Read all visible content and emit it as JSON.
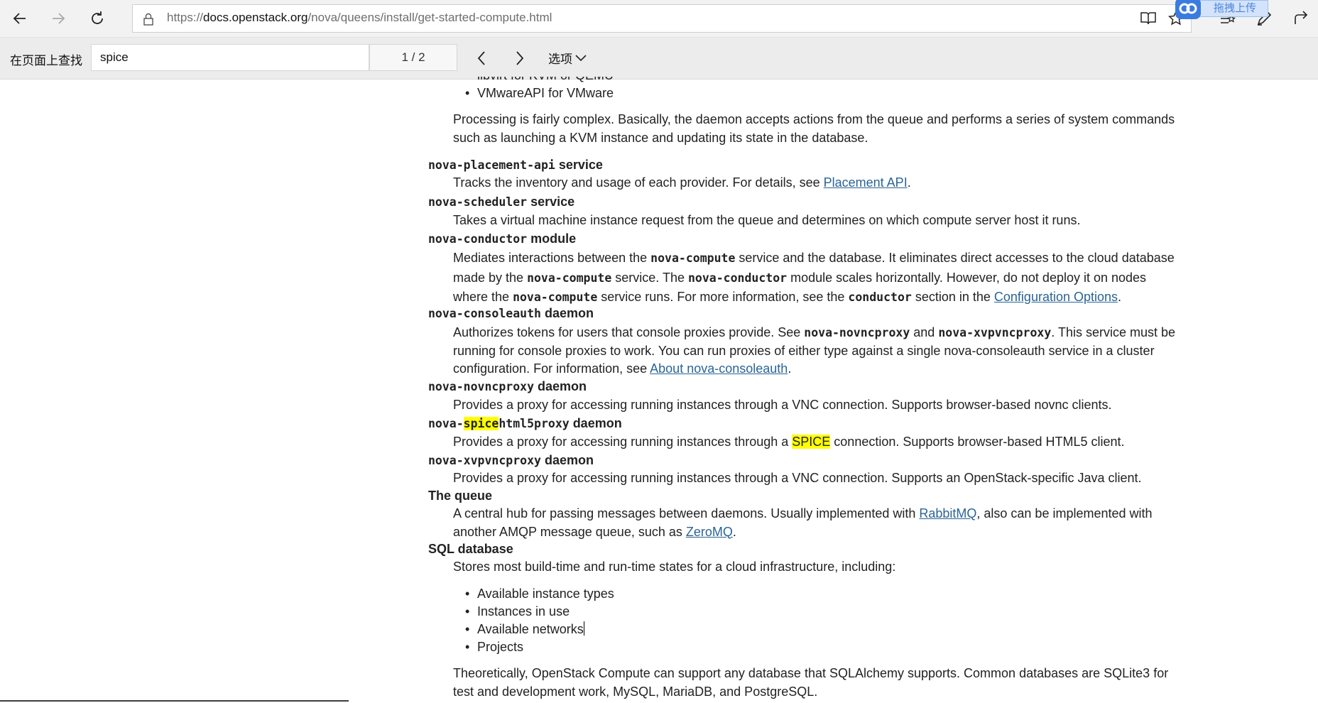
{
  "browser": {
    "url_prefix": "https://",
    "url_host": "docs.openstack.org",
    "url_path": "/nova/queens/install/get-started-compute.html",
    "upload_badge": "拖拽上传"
  },
  "findbar": {
    "label": "在页面上查找",
    "query": "spice",
    "count": "1 / 2",
    "options_label": "选项"
  },
  "content": {
    "cut_item": "libvirt for KVM or QEMU",
    "top_item": "VMwareAPI for VMware",
    "processing": "Processing is fairly complex. Basically, the daemon accepts actions from the queue and performs a series of system commands such as launching a KVM instance and updating its state in the database.",
    "placement": {
      "term": "nova-placement-api",
      "kind": " service",
      "desc": "Tracks the inventory and usage of each provider. For details, see ",
      "link": "Placement API",
      "end": "."
    },
    "scheduler": {
      "term": "nova-scheduler",
      "kind": " service",
      "desc": "Takes a virtual machine instance request from the queue and determines on which compute server host it runs."
    },
    "conductor": {
      "term": "nova-conductor",
      "kind": " module",
      "p1": "Mediates interactions between the ",
      "c1": "nova-compute",
      "p2": " service and the database. It eliminates direct accesses to the cloud database made by the ",
      "c2": "nova-compute",
      "p3": " service. The ",
      "c3": "nova-conductor",
      "p4": " module scales horizontally. However, do not deploy it on nodes where the ",
      "c4": "nova-compute",
      "p5": " service runs. For more information, see the ",
      "c5": "conductor",
      "p6": " section in the ",
      "link": "Configuration Options",
      "end": "."
    },
    "consoleauth": {
      "term": "nova-consoleauth",
      "kind": " daemon",
      "p1": "Authorizes tokens for users that console proxies provide. See ",
      "c1": "nova-novncproxy",
      "p2": " and ",
      "c2": "nova-xvpvncproxy",
      "p3": ". This service must be running for console proxies to work. You can run proxies of either type against a single nova-consoleauth service in a cluster configuration. For information, see ",
      "link": "About nova-consoleauth",
      "end": "."
    },
    "novnc": {
      "term": "nova-novncproxy",
      "kind": " daemon",
      "desc": "Provides a proxy for accessing running instances through a VNC connection. Supports browser-based novnc clients."
    },
    "spice": {
      "term_a": "nova-",
      "term_hl": "spice",
      "term_b": "html5proxy",
      "kind": " daemon",
      "p1": "Provides a proxy for accessing running instances through a ",
      "hl": "SPICE",
      "p2": " connection. Supports browser-based HTML5 client."
    },
    "xvp": {
      "term": "nova-xvpvncproxy",
      "kind": " daemon",
      "desc": "Provides a proxy for accessing running instances through a VNC connection. Supports an OpenStack-specific Java client."
    },
    "queue": {
      "term": "The queue",
      "p1": "A central hub for passing messages between daemons. Usually implemented with ",
      "link1": "RabbitMQ",
      "p2": ", also can be implemented with another AMQP message queue, such as ",
      "link2": "ZeroMQ",
      "end": "."
    },
    "sql": {
      "term": "SQL database",
      "desc": "Stores most build-time and run-time states for a cloud infrastructure, including:",
      "items": [
        "Available instance types",
        "Instances in use",
        "Available networks",
        "Projects"
      ],
      "footer": "Theoretically, OpenStack Compute can support any database that SQLAlchemy supports. Common databases are SQLite3 for test and development work, MySQL, MariaDB, and PostgreSQL."
    }
  }
}
